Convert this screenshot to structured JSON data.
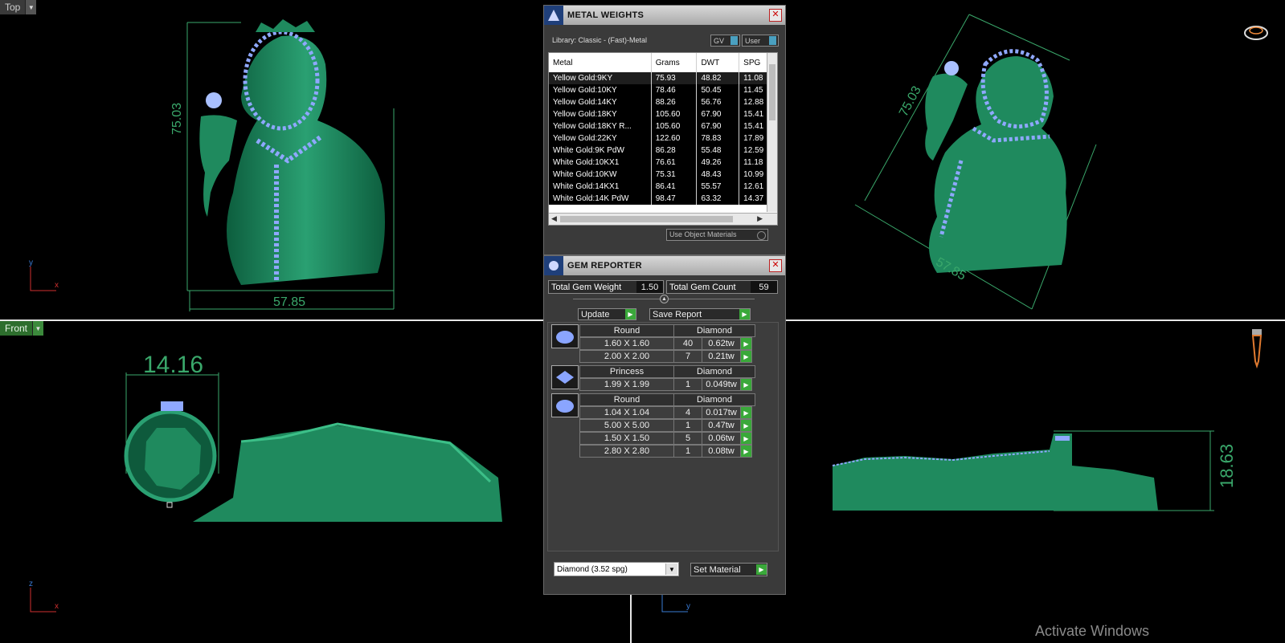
{
  "viewports": {
    "top_label": "Top",
    "front_label": "Front",
    "top_dim_height": "75.03",
    "top_dim_width": "57.85",
    "iso_dim_height": "75.03",
    "iso_dim_width": "57.85",
    "front_dim": "14.16",
    "side_dim": "18.63",
    "axes": {
      "y": "y",
      "x": "x",
      "z": "z"
    }
  },
  "watermark": "Activate Windows",
  "metal_weights": {
    "title": "METAL WEIGHTS",
    "library": "Library: Classic - (Fast)-Metal",
    "gv_label": "GV",
    "user_label": "User",
    "columns": [
      "Metal",
      "Grams",
      "DWT",
      "SPG"
    ],
    "rows": [
      [
        "Yellow Gold:9KY",
        "75.93",
        "48.82",
        "11.08"
      ],
      [
        "Yellow Gold:10KY",
        "78.46",
        "50.45",
        "11.45"
      ],
      [
        "Yellow Gold:14KY",
        "88.26",
        "56.76",
        "12.88"
      ],
      [
        "Yellow Gold:18KY",
        "105.60",
        "67.90",
        "15.41"
      ],
      [
        "Yellow Gold:18KY R...",
        "105.60",
        "67.90",
        "15.41"
      ],
      [
        "Yellow Gold:22KY",
        "122.60",
        "78.83",
        "17.89"
      ],
      [
        "White Gold:9K PdW",
        "86.28",
        "55.48",
        "12.59"
      ],
      [
        "White Gold:10KX1",
        "76.61",
        "49.26",
        "11.18"
      ],
      [
        "White Gold:10KW",
        "75.31",
        "48.43",
        "10.99"
      ],
      [
        "White Gold:14KX1",
        "86.41",
        "55.57",
        "12.61"
      ],
      [
        "White Gold:14K PdW",
        "98.47",
        "63.32",
        "14.37"
      ]
    ],
    "use_object_materials": "Use Object Materials"
  },
  "gem_reporter": {
    "title": "GEM REPORTER",
    "total_weight_label": "Total Gem Weight",
    "total_weight_value": "1.50",
    "total_count_label": "Total Gem Count",
    "total_count_value": "59",
    "update_label": "Update",
    "save_report_label": "Save Report",
    "groups": [
      {
        "shape": "Round",
        "material": "Diamond",
        "rows": [
          [
            "1.60 X 1.60",
            "40",
            "0.62tw"
          ],
          [
            "2.00 X 2.00",
            "7",
            "0.21tw"
          ]
        ]
      },
      {
        "shape": "Princess",
        "material": "Diamond",
        "rows": [
          [
            "1.99 X 1.99",
            "1",
            "0.049tw"
          ]
        ]
      },
      {
        "shape": "Round",
        "material": "Diamond",
        "rows": [
          [
            "1.04 X 1.04",
            "4",
            "0.017tw"
          ],
          [
            "5.00 X 5.00",
            "1",
            "0.47tw"
          ],
          [
            "1.50 X 1.50",
            "5",
            "0.06tw"
          ],
          [
            "2.80 X 2.80",
            "1",
            "0.08tw"
          ]
        ]
      }
    ],
    "material_select": "Diamond     (3.52 spg)",
    "set_material_label": "Set Material"
  },
  "colors": {
    "model": "#1f8a5e",
    "gem": "#8fa8ff",
    "dim": "#3aa86b"
  }
}
